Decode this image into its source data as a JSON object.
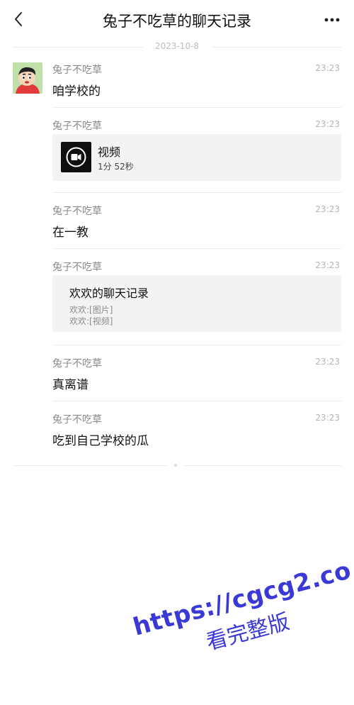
{
  "header": {
    "title": "兔子不吃草的聊天记录",
    "back_icon": "chevron-left-icon",
    "more_icon": "more-dots-icon"
  },
  "date_separator": "2023-10-8",
  "messages": [
    {
      "sender": "兔子不吃草",
      "time": "23:23",
      "text": "咱学校的"
    },
    {
      "sender": "兔子不吃草",
      "time": "23:23",
      "video": {
        "title": "视频",
        "duration": "1分 52秒"
      }
    },
    {
      "sender": "兔子不吃草",
      "time": "23:23",
      "text": "在一教"
    },
    {
      "sender": "兔子不吃草",
      "time": "23:23",
      "record": {
        "title": "欢欢的聊天记录",
        "lines": [
          "欢欢:[图片]",
          "欢欢:[视频]"
        ]
      }
    },
    {
      "sender": "兔子不吃草",
      "time": "23:23",
      "text": "真离谱"
    },
    {
      "sender": "兔子不吃草",
      "time": "23:23",
      "text": "吃到自己学校的瓜"
    }
  ],
  "watermark": {
    "url": "https://cgcg2.co",
    "subtitle": "看完整版"
  },
  "colors": {
    "watermark": "#3b39d6",
    "divider": "#ececec",
    "meta_text": "#8a8a8a"
  }
}
